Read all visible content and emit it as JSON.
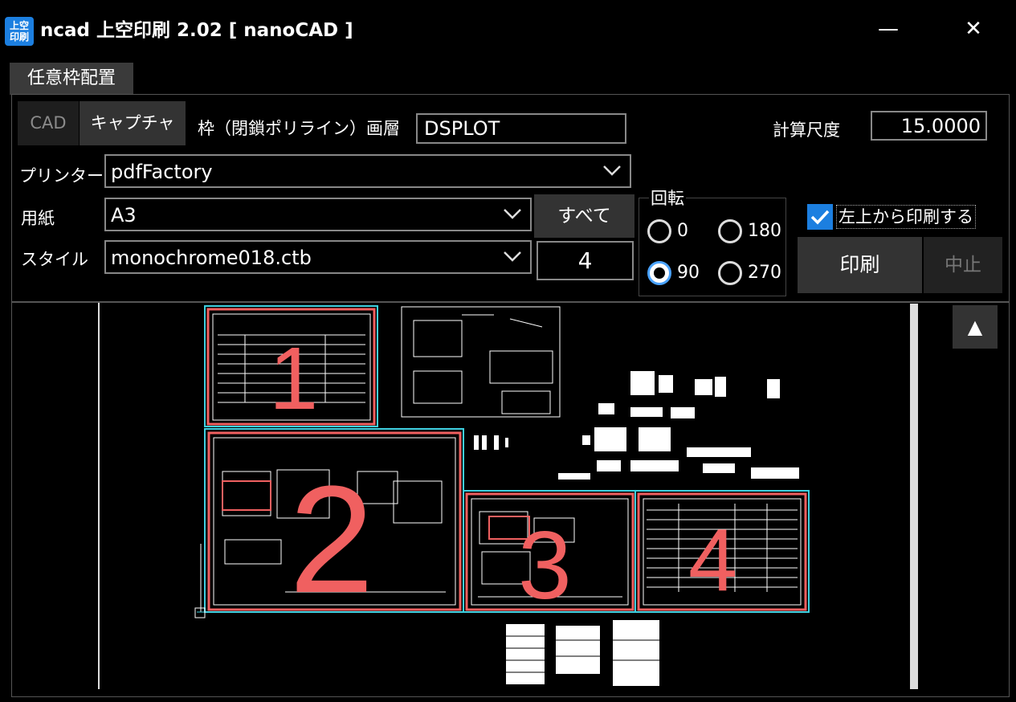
{
  "window": {
    "icon_text_top": "上空",
    "icon_text_bottom": "印刷",
    "title": "ncad 上空印刷 2.02 [ nanoCAD ]",
    "min_glyph": "—",
    "close_glyph": "✕"
  },
  "tab": {
    "label": "任意枠配置"
  },
  "source_toggle": {
    "cad": "CAD",
    "capture": "キャプチャ",
    "selected": "capture"
  },
  "frame_layer": {
    "label": "枠（閉鎖ポリライン）画層",
    "value": "DSPLOT"
  },
  "scale": {
    "label": "計算尺度",
    "value": "15.0000"
  },
  "printer": {
    "label": "プリンター",
    "value": "pdfFactory"
  },
  "paper": {
    "label": "用紙",
    "value": "A3"
  },
  "style": {
    "label": "スタイル",
    "value": "monochrome018.ctb"
  },
  "all_button": {
    "label": "すべて"
  },
  "count": {
    "value": "4"
  },
  "rotation": {
    "label": "回転",
    "options": [
      "0",
      "180",
      "90",
      "270"
    ],
    "selected": "90"
  },
  "top_left_print": {
    "label": "左上から印刷する",
    "checked": true
  },
  "print_button": {
    "label": "印刷"
  },
  "stop_button": {
    "label": "中止"
  },
  "preview": {
    "frame_numbers": [
      "1",
      "2",
      "3",
      "4"
    ],
    "scroll_up_glyph": "▲"
  },
  "colors": {
    "accent": "#1c7fe0",
    "frame_red": "#f06060",
    "frame_cyan": "#3ed0e0"
  }
}
